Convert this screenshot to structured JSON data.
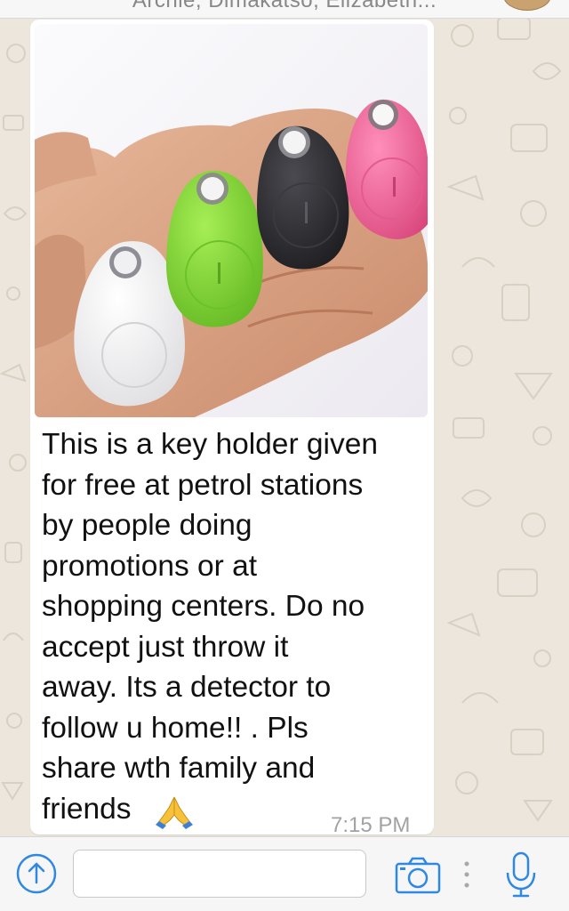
{
  "header": {
    "participants_text": "Archie, Dimakatso, Elizabeth..."
  },
  "message": {
    "text": "This is a key holder given\nfor free at petrol stations\nby people doing\npromotions or at\nshopping centers. Do no\naccept  just throw it\naway. Its a detector to\nfollow u home!! . Pls\nshare wth family and\nfriends",
    "emoji_icon": "folded-hands-icon",
    "time": "7:15 PM"
  },
  "photo": {
    "content": "keyfinder-tags-in-hand",
    "tag_colors": [
      "#f7f7f7",
      "#86d83a",
      "#2b2b2e",
      "#f0669a"
    ]
  },
  "input_bar": {
    "placeholder": "",
    "attach_icon": "upload-arrow-icon",
    "camera_icon": "camera-icon",
    "mic_icon": "microphone-icon"
  },
  "colors": {
    "accent": "#2f89e3",
    "bubble": "#ffffff",
    "wallpaper": "#ece6dc",
    "timestamp": "#a2a2a2"
  }
}
